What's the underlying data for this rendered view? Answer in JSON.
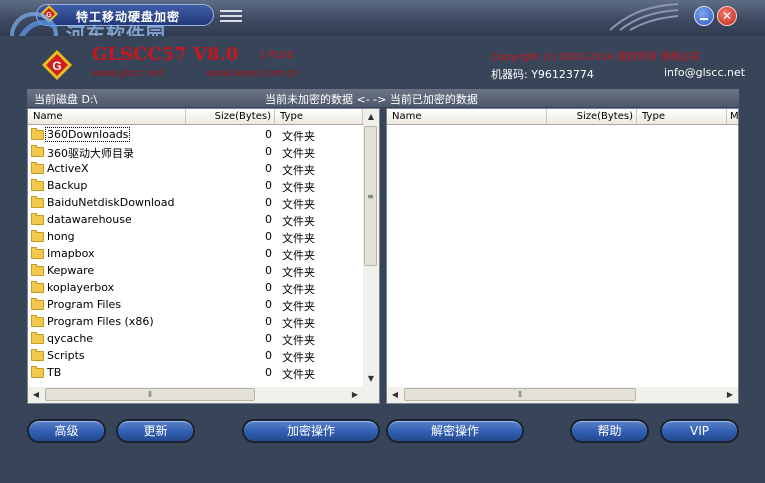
{
  "window": {
    "title": "特工移动硬盘加密",
    "close_glyph": "✕"
  },
  "watermark": {
    "text": "河东软件园"
  },
  "header": {
    "product_name": "GLSCC57 V8.0",
    "edition": "1 PLUS",
    "url1": "www.glscc.net",
    "url2": "www.leese.com.cn",
    "copyright": "Copyright (c) 2003-2014 版权所有 侵权必究",
    "machine_code": "机器码: Y96123774",
    "email": "info@glscc.net"
  },
  "status": {
    "current_disk": "当前磁盘 D:\\",
    "message": "当前未加密的数据 <- -> 当前已加密的数据"
  },
  "left_panel": {
    "columns": {
      "name": "Name",
      "size": "Size(Bytes)",
      "type": "Type"
    },
    "rows": [
      {
        "name": "360Downloads",
        "size": "0",
        "type": "文件夹"
      },
      {
        "name": "360驱动大师目录",
        "size": "0",
        "type": "文件夹"
      },
      {
        "name": "ActiveX",
        "size": "0",
        "type": "文件夹"
      },
      {
        "name": "Backup",
        "size": "0",
        "type": "文件夹"
      },
      {
        "name": "BaiduNetdiskDownload",
        "size": "0",
        "type": "文件夹"
      },
      {
        "name": "datawarehouse",
        "size": "0",
        "type": "文件夹"
      },
      {
        "name": "hong",
        "size": "0",
        "type": "文件夹"
      },
      {
        "name": "Imapbox",
        "size": "0",
        "type": "文件夹"
      },
      {
        "name": "Kepware",
        "size": "0",
        "type": "文件夹"
      },
      {
        "name": "koplayerbox",
        "size": "0",
        "type": "文件夹"
      },
      {
        "name": "Program Files",
        "size": "0",
        "type": "文件夹"
      },
      {
        "name": "Program Files (x86)",
        "size": "0",
        "type": "文件夹"
      },
      {
        "name": "qycache",
        "size": "0",
        "type": "文件夹"
      },
      {
        "name": "Scripts",
        "size": "0",
        "type": "文件夹"
      },
      {
        "name": "TB",
        "size": "0",
        "type": "文件夹"
      }
    ]
  },
  "right_panel": {
    "columns": {
      "name": "Name",
      "size": "Size(Bytes)",
      "type": "Type",
      "extra": "M"
    }
  },
  "buttons": {
    "advanced": "高级",
    "refresh": "更新",
    "encrypt": "加密操作",
    "decrypt": "解密操作",
    "help": "帮助",
    "vip": "VIP"
  },
  "icons": {
    "logo": "g-diamond-logo",
    "menu": "menu-icon",
    "minimize": "minimize-icon",
    "close": "close-icon",
    "folder": "folder-icon"
  },
  "colors": {
    "frame": "#384458",
    "brand_red": "#c8161d",
    "button_blue": "#3360b4"
  }
}
